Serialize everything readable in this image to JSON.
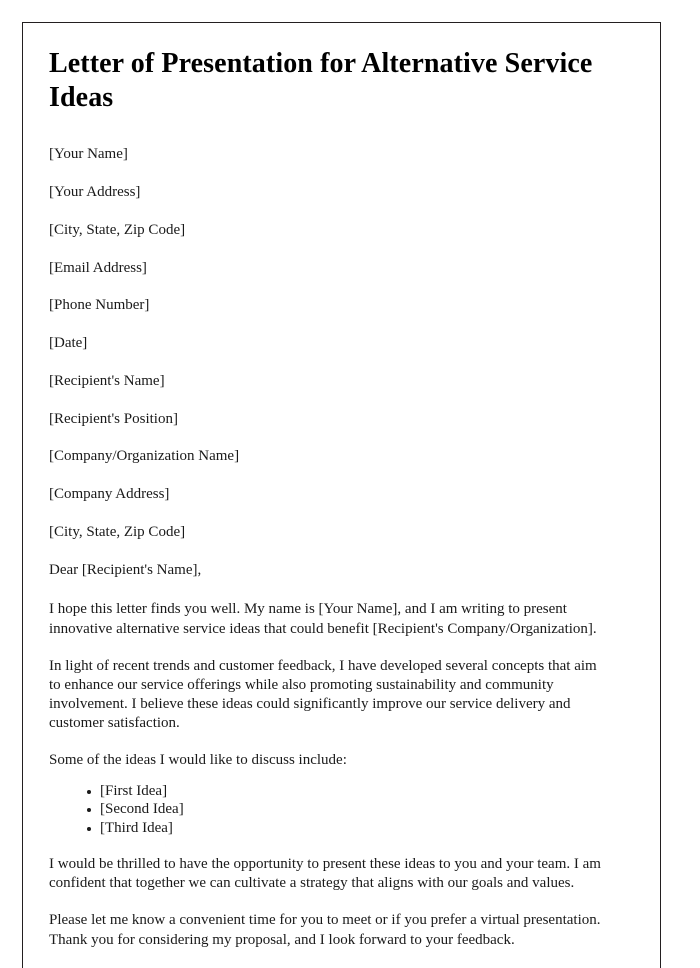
{
  "document": {
    "title": "Letter of Presentation for Alternative Service Ideas",
    "sender_fields": [
      "[Your Name]",
      "[Your Address]",
      "[City, State, Zip Code]",
      "[Email Address]",
      "[Phone Number]",
      "[Date]"
    ],
    "recipient_fields": [
      "[Recipient's Name]",
      "[Recipient's Position]",
      "[Company/Organization Name]",
      "[Company Address]",
      "[City, State, Zip Code]"
    ],
    "salutation": "Dear [Recipient's Name],",
    "paragraphs": [
      "I hope this letter finds you well. My name is [Your Name], and I am writing to present innovative alternative service ideas that could benefit [Recipient's Company/Organization].",
      "In light of recent trends and customer feedback, I have developed several concepts that aim to enhance our service offerings while also promoting sustainability and community involvement. I believe these ideas could significantly improve our service delivery and customer satisfaction."
    ],
    "list_lead_in": "Some of the ideas I would like to discuss include:",
    "ideas": [
      "[First Idea]",
      "[Second Idea]",
      "[Third Idea]"
    ],
    "closing_paragraphs": [
      "I would be thrilled to have the opportunity to present these ideas to you and your team. I am confident that together we can cultivate a strategy that aligns with our goals and values.",
      "Please let me know a convenient time for you to meet or if you prefer a virtual presentation. Thank you for considering my proposal, and I look forward to your feedback."
    ],
    "colors": {
      "page_border": "#231f20",
      "text": "#1a1a1a",
      "title": "#000000",
      "background": "#ffffff"
    }
  }
}
